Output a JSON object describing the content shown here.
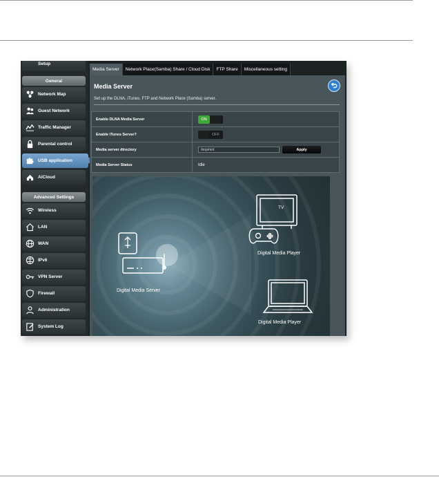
{
  "sidebar": {
    "setup_label": "Setup",
    "general_header": "General",
    "general_items": [
      {
        "label": "Network Map",
        "icon": "network-map-icon"
      },
      {
        "label": "Guest Network",
        "icon": "guest-network-icon"
      },
      {
        "label": "Traffic Manager",
        "icon": "traffic-manager-icon"
      },
      {
        "label": "Parental control",
        "icon": "lock-icon"
      },
      {
        "label": "USB application",
        "icon": "usb-puzzle-icon"
      },
      {
        "label": "AiCloud",
        "icon": "cloud-house-icon"
      }
    ],
    "advanced_header": "Advanced Settings",
    "advanced_items": [
      {
        "label": "Wireless",
        "icon": "wifi-icon"
      },
      {
        "label": "LAN",
        "icon": "home-icon"
      },
      {
        "label": "WAN",
        "icon": "globe-icon"
      },
      {
        "label": "IPv6",
        "icon": "ipv6-globe-icon"
      },
      {
        "label": "VPN Server",
        "icon": "vpn-icon"
      },
      {
        "label": "Firewall",
        "icon": "shield-icon"
      },
      {
        "label": "Administration",
        "icon": "admin-user-icon"
      },
      {
        "label": "System Log",
        "icon": "log-icon"
      }
    ]
  },
  "tabs": [
    "Media Server",
    "Network Place(Samba) Share / Cloud Disk",
    "FTP Share",
    "Miscellaneous setting"
  ],
  "main": {
    "title": "Media Server",
    "description": "Set up the DLNA, iTunes, FTP and Network Place (Samba) server.",
    "rows": {
      "dlna_label": "Enable DLNA Media Server",
      "dlna_state": "ON",
      "itunes_label": "Enable iTunes Server?",
      "itunes_state": "OFF",
      "dir_label": "Media server directory",
      "dir_value": "/tmp/mnt",
      "apply_label": "Apply",
      "status_label": "Media Server Status",
      "status_value": "Idle"
    }
  },
  "illustration": {
    "tv_label": "TV",
    "player1_label": "Digital  Media Player",
    "server_label": "Digital  Media Server",
    "player2_label": "Digital  Media Player"
  },
  "colors": {
    "active_nav": "#5d8bb6",
    "toggle_on": "#3fa935",
    "back_button": "#2c7fd3"
  }
}
